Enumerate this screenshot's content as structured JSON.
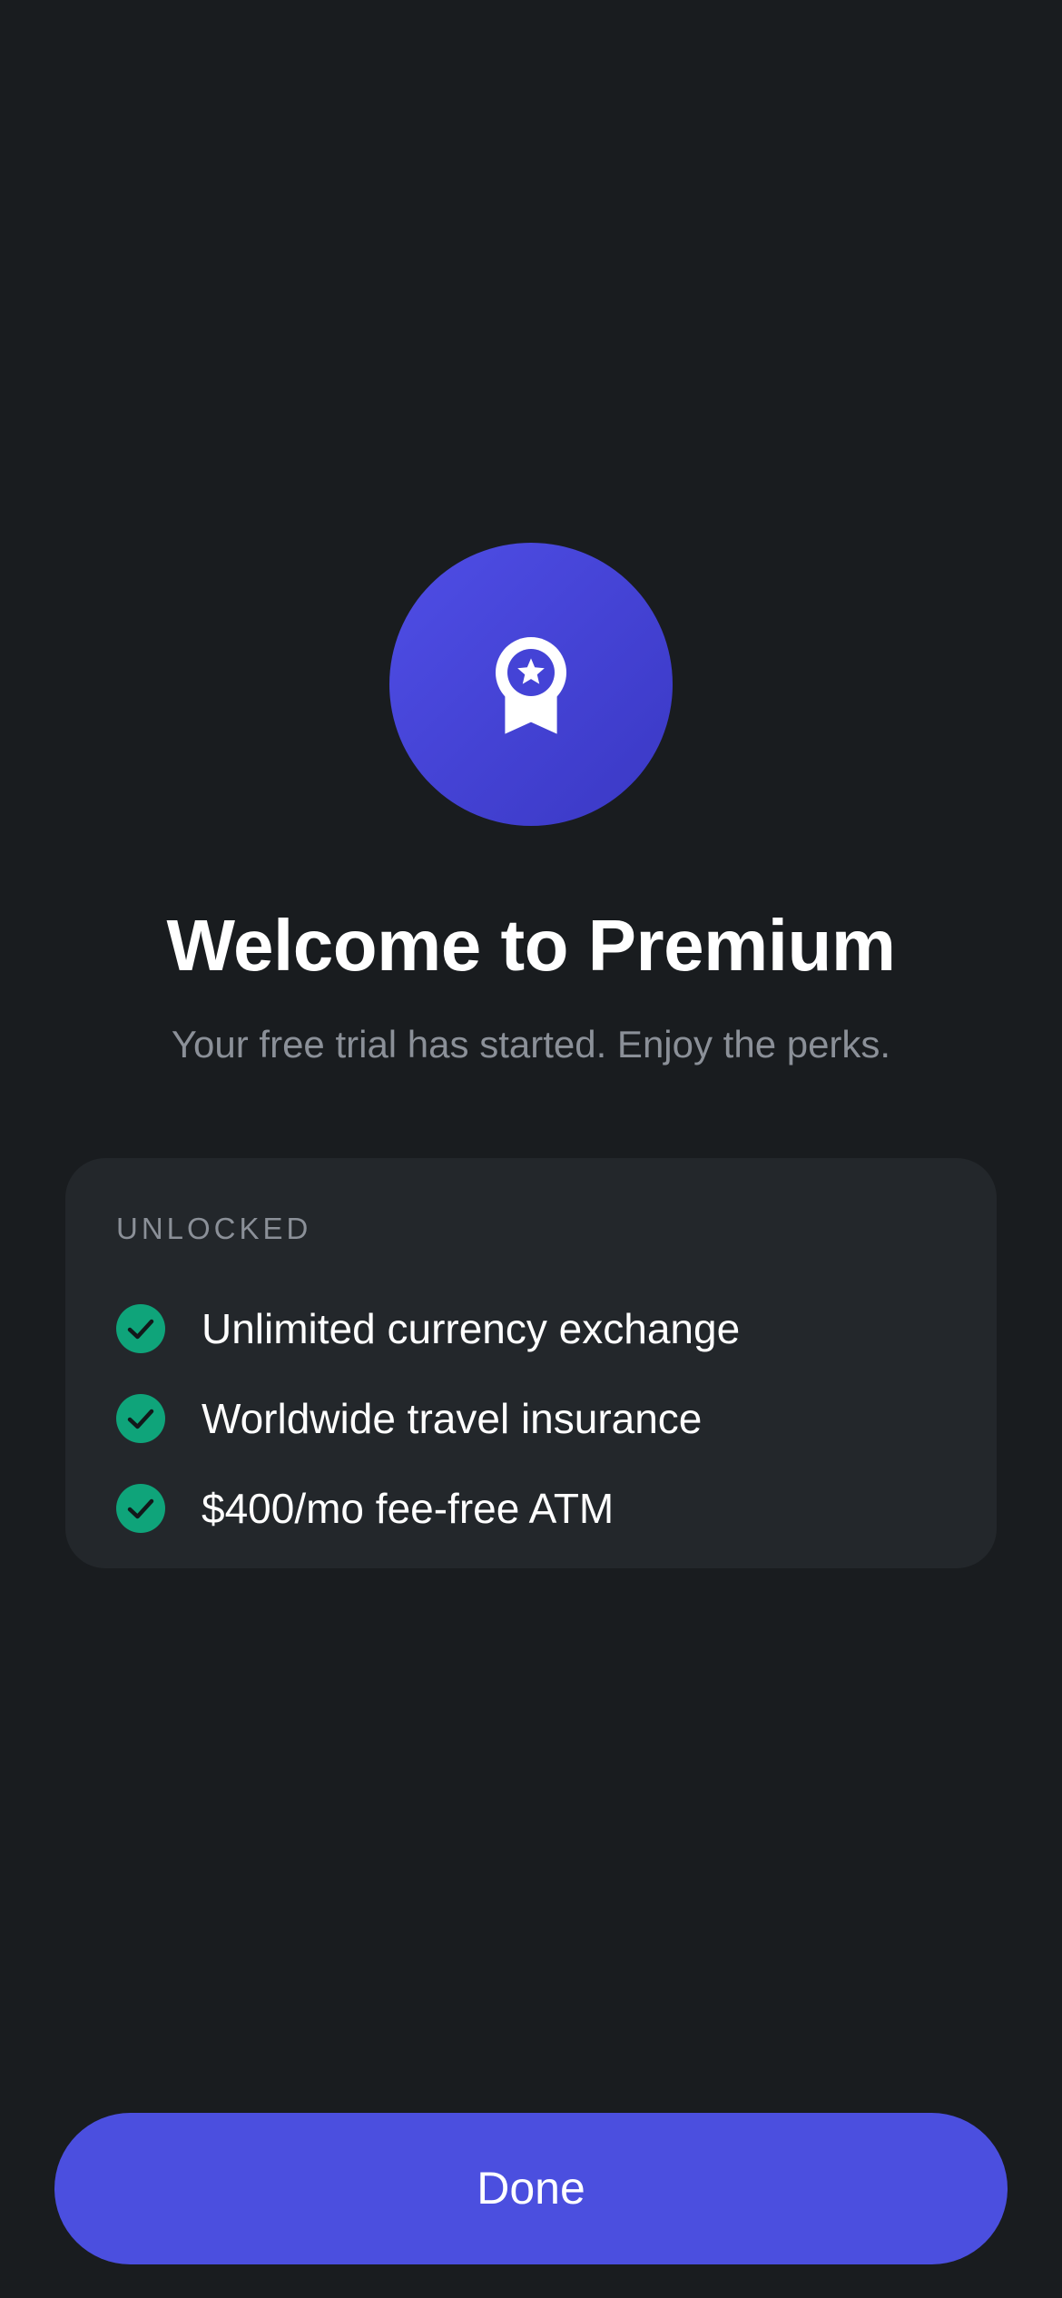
{
  "hero": {
    "icon": "award-ribbon-icon",
    "title": "Welcome to Premium",
    "subtitle": "Your free trial has started. Enjoy the perks."
  },
  "unlocked": {
    "label": "UNLOCKED",
    "items": [
      {
        "label": "Unlimited currency exchange",
        "icon": "check-circle-icon"
      },
      {
        "label": "Worldwide travel insurance",
        "icon": "check-circle-icon"
      },
      {
        "label": "$400/mo fee-free ATM",
        "icon": "check-circle-icon"
      }
    ]
  },
  "actions": {
    "done_label": "Done"
  },
  "colors": {
    "background": "#191c1f",
    "card": "#23272b",
    "accent": "#4b4fdf",
    "success": "#0fa47a",
    "muted_text": "#8b9098"
  }
}
